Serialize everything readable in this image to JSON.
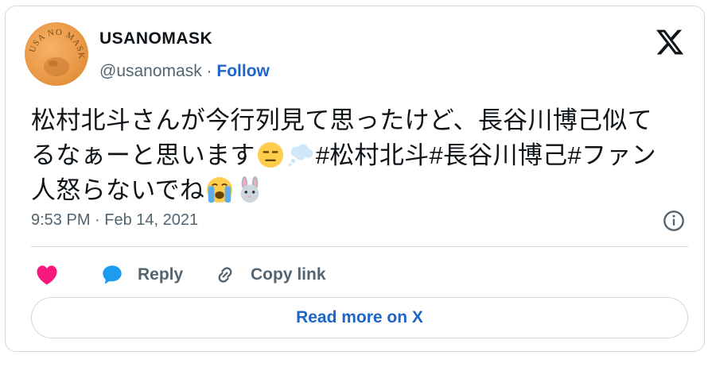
{
  "author": {
    "display_name": "USANOMASK",
    "handle": "@usanomask",
    "separator": " · ",
    "follow_label": "Follow",
    "avatar_text": "USA NO MASK"
  },
  "tweet": {
    "line1": "松村北斗さんが今行列見て思ったけど、長谷川博己似て",
    "line2_a": "るなぁーと思います",
    "line2_b": "#松村北斗#長谷川博己#ファン",
    "line3": "人怒らないでね",
    "emojis": [
      "expressionless-face-emoji",
      "thought-balloon-emoji",
      "loudly-crying-face-emoji",
      "rabbit-face-emoji"
    ]
  },
  "timestamp": "9:53 PM · Feb 14, 2021",
  "actions": {
    "reply_label": "Reply",
    "copy_label": "Copy link"
  },
  "read_more_label": "Read more on X",
  "colors": {
    "accent": "#1d65c9",
    "like": "#f91880",
    "reply_icon": "#1d9bf0",
    "muted": "#536471",
    "border": "#cfd9de"
  }
}
